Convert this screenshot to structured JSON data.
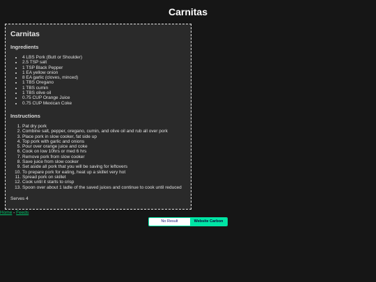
{
  "page": {
    "title": "Carnitas"
  },
  "recipe": {
    "title": "Carnitas",
    "ingredients_heading": "Ingredients",
    "ingredients": [
      "4 LBS Pork (Butt or Shoulder)",
      "2.5 TSP salt",
      "1 TSP Black Pepper",
      "1 EA yellow onion",
      "8 EA garlic (cloves, minced)",
      "1 TBS Oregano",
      "1 TBS cumin",
      "1 TBS olive oil",
      "0.75 CUP Orange Juice",
      "0.75 CUP Mexican Coke"
    ],
    "instructions_heading": "Instructions",
    "instructions": [
      "Pat dry pork",
      "Combine salt, pepper, oregano, cumin, and olive oil and rub all over pork",
      "Place pork in slow cooker, fat side up",
      "Top pork with garlic and onions",
      "Pour over orange juice and coke",
      "Cook on low 10hrs or med 6 hrs",
      "Remove pork from slow cooker",
      "Save juice from slow cooker",
      "Set aside all pork that you will be saving for leftovers",
      "To prepare pork for eating, heat up a skillet very hot",
      "Spread pork on skillet",
      "Cook until it starts to crisp",
      "Spoon over about 1 ladle of the saved juices and continue to cook until reduced"
    ],
    "serves": "Serves 4"
  },
  "footer": {
    "home_label": "Home",
    "separator": " - ",
    "feeds_label": "Feeds"
  },
  "badge": {
    "result_label": "No Result",
    "brand_label": "Website Carbon"
  },
  "colors": {
    "background": "#161616",
    "card_background": "#2a2a2a",
    "link": "#00c26a",
    "badge_accent": "#00e6a5"
  }
}
